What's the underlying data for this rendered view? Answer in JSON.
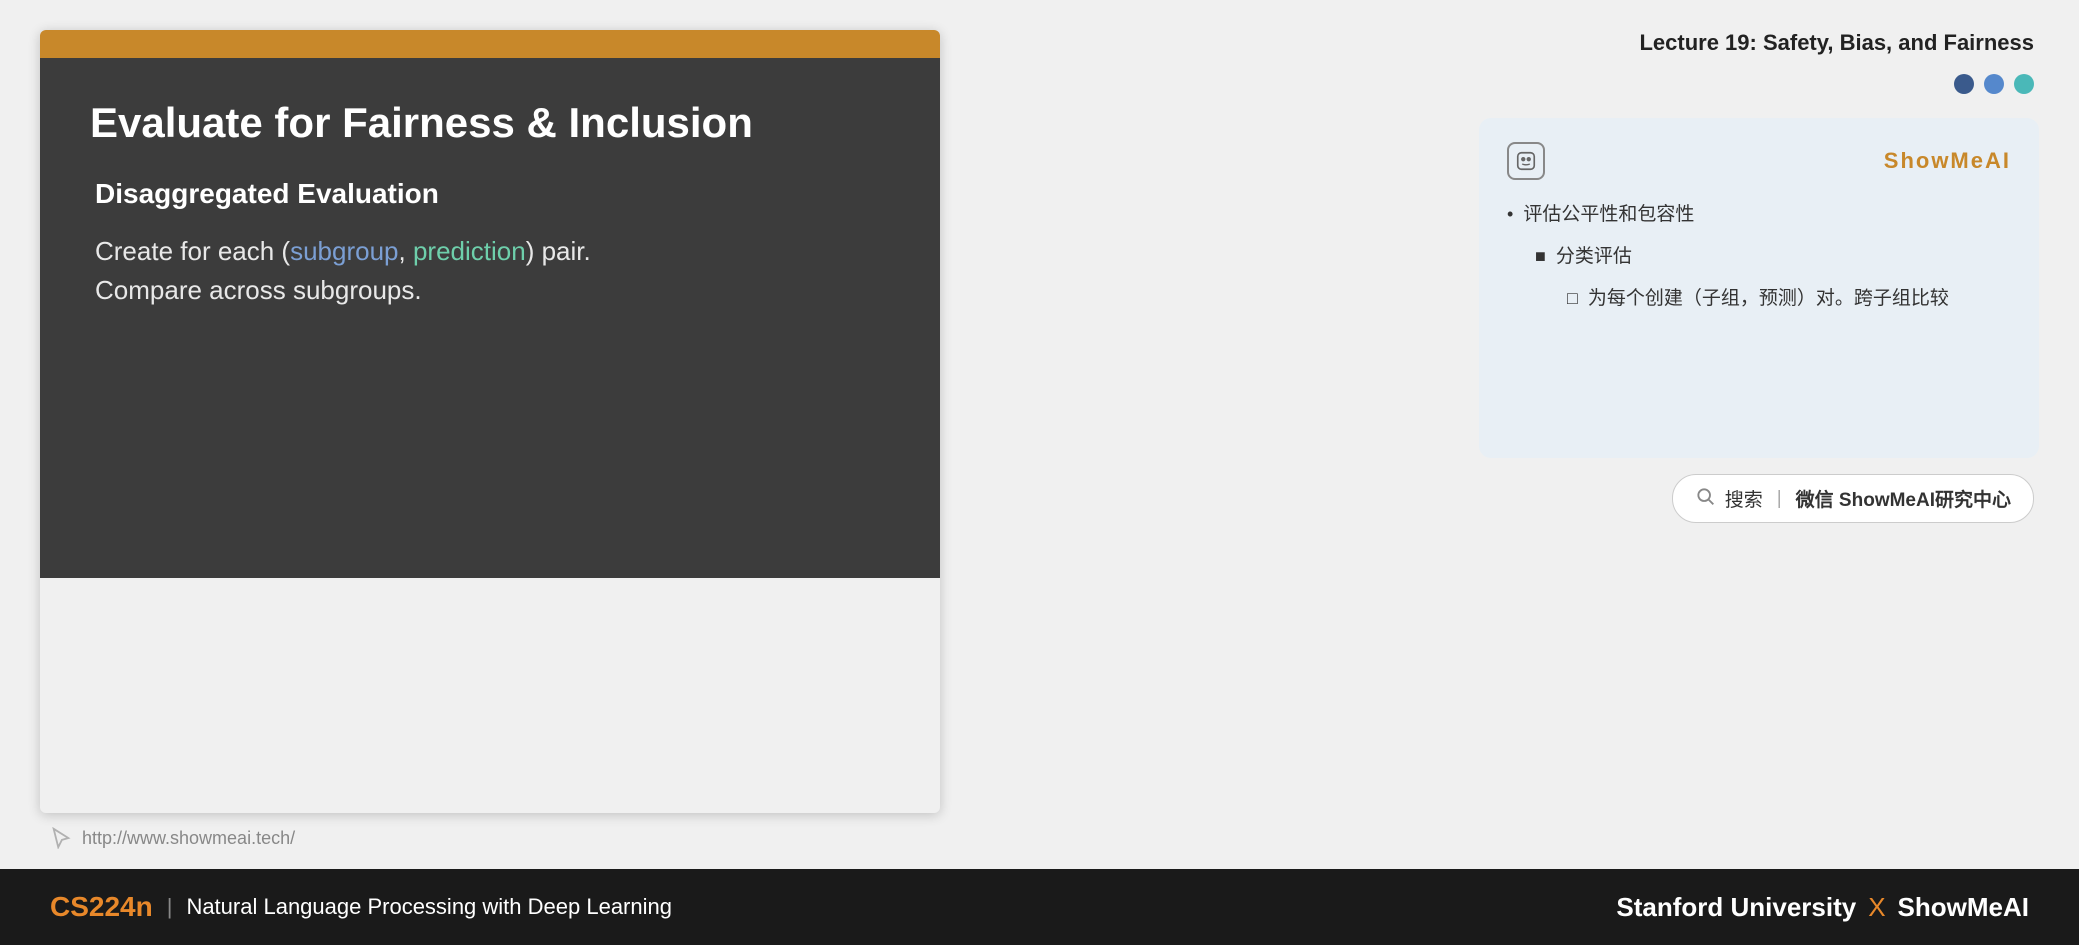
{
  "header": {
    "lecture_title": "Lecture 19: Safety, Bias, and Fairness"
  },
  "dots": [
    {
      "color": "dot-dark-blue",
      "label": "dot-1"
    },
    {
      "color": "dot-blue",
      "label": "dot-2"
    },
    {
      "color": "dot-teal",
      "label": "dot-3"
    }
  ],
  "slide": {
    "title": "Evaluate for Fairness & Inclusion",
    "subtitle": "Disaggregated Evaluation",
    "text_line1": "Create for each (",
    "subgroup_word": "subgroup",
    "comma_text": ", ",
    "prediction_word": "prediction",
    "text_after": ") pair.",
    "text_line2": "Compare across subgroups.",
    "url": "http://www.showmeai.tech/"
  },
  "notes_card": {
    "brand": "ShowMeAI",
    "bullet1": "评估公平性和包容性",
    "bullet2": "分类评估",
    "bullet3": "为每个创建（子组，预测）对。跨子组比较"
  },
  "search": {
    "icon_label": "搜索",
    "divider": "|",
    "text": "微信 ShowMeAI研究中心"
  },
  "footer": {
    "course_code": "CS224n",
    "pipe": "|",
    "course_desc": "Natural Language Processing with Deep Learning",
    "stanford": "Stanford University",
    "x": "X",
    "showmeai": "ShowMeAI"
  }
}
